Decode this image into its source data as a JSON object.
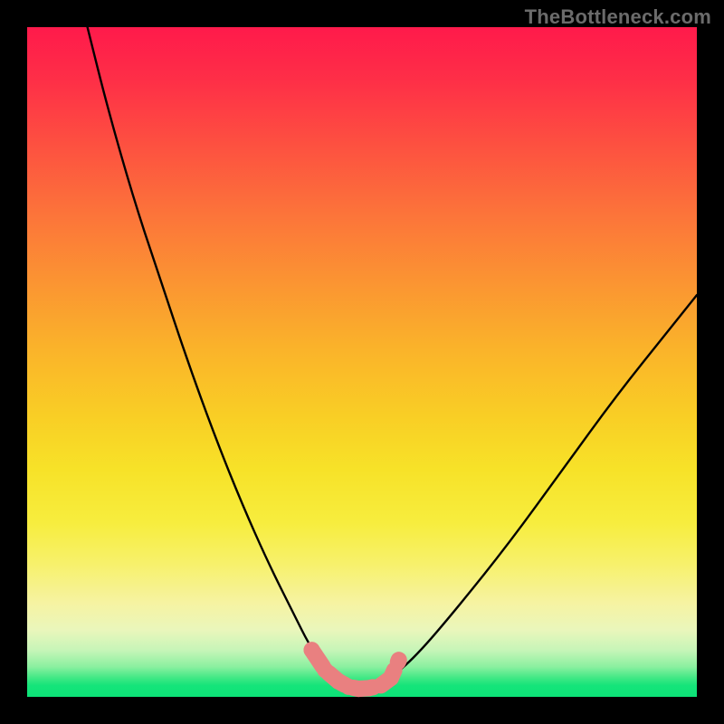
{
  "watermark": "TheBottleneck.com",
  "colors": {
    "page_bg": "#000000",
    "curve": "#000000",
    "marker": "#e98080",
    "gradient_top": "#ff1a4b",
    "gradient_bottom": "#0ce277"
  },
  "chart_data": {
    "type": "line",
    "title": "",
    "xlabel": "",
    "ylabel": "",
    "xlim": [
      0,
      100
    ],
    "ylim": [
      0,
      100
    ],
    "grid": false,
    "legend": false,
    "series": [
      {
        "name": "bottleneck-curve",
        "x": [
          9,
          12,
          16,
          20,
          24,
          28,
          32,
          36,
          40,
          42,
          44,
          46,
          48,
          50,
          52,
          54,
          58,
          64,
          72,
          80,
          88,
          96,
          100
        ],
        "y": [
          100,
          88,
          74,
          62,
          50,
          39,
          29,
          20,
          12,
          8,
          5,
          2.5,
          1.5,
          1.2,
          1.4,
          2.6,
          6,
          13,
          23,
          34,
          45,
          55,
          60
        ]
      }
    ],
    "markers": {
      "name": "trough-markers",
      "color": "#e98080",
      "x": [
        42.5,
        44.5,
        46.5,
        48.0,
        49.5,
        51.0,
        52.8,
        54.3,
        55.5
      ],
      "y": [
        7.0,
        4.0,
        2.3,
        1.5,
        1.2,
        1.3,
        1.7,
        2.8,
        5.5
      ]
    }
  }
}
